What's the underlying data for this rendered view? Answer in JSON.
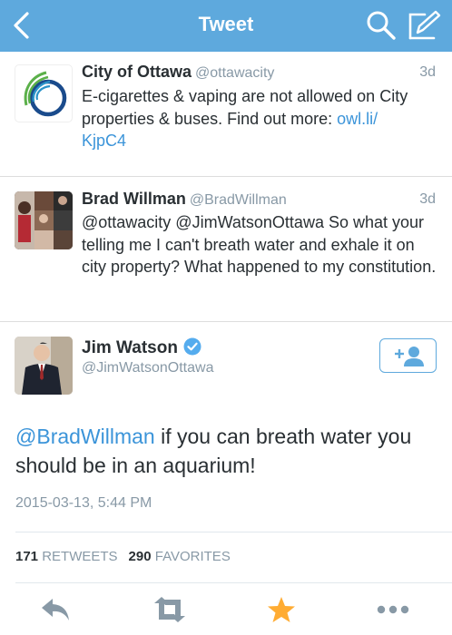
{
  "nav": {
    "title": "Tweet",
    "back_icon": "chevron-left-icon",
    "search_icon": "search-icon",
    "compose_icon": "compose-icon",
    "bar_color": "#5ea9dd"
  },
  "replies_above": [
    {
      "name": "City of Ottawa",
      "handle": "@ottawacity",
      "time": "3d",
      "text_before_link": "E-cigarettes & vaping are not allowed on City properties & buses. Find out more: ",
      "link": "owl.li/\nKjpC4"
    },
    {
      "name": "Brad Willman",
      "handle": "@BradWillman",
      "time": "3d",
      "text": "@ottawacity @JimWatsonOttawa So what your telling me I can't breath water and exhale it on city property? What happened to my constitution."
    }
  ],
  "main_tweet": {
    "name": "Jim Watson",
    "handle": "@JimWatsonOttawa",
    "verified_icon": "verified-badge-icon",
    "follow_icon": "add-user-icon",
    "mention": "@BradWillman",
    "text": " if you can breath water you should be in an aquarium!",
    "date": "2015-03-13, 5:44 PM",
    "retweets_count": "171",
    "retweets_label": "RETWEETS",
    "favorites_count": "290",
    "favorites_label": "FAVORITES"
  },
  "actions": {
    "reply_icon": "reply-icon",
    "retweet_icon": "retweet-icon",
    "favorite_icon": "star-icon",
    "more_icon": "more-dots-icon",
    "favorite_color": "#ffac33"
  },
  "colors": {
    "link": "#3b94d9",
    "muted": "#8899a6",
    "text": "#292f33"
  }
}
